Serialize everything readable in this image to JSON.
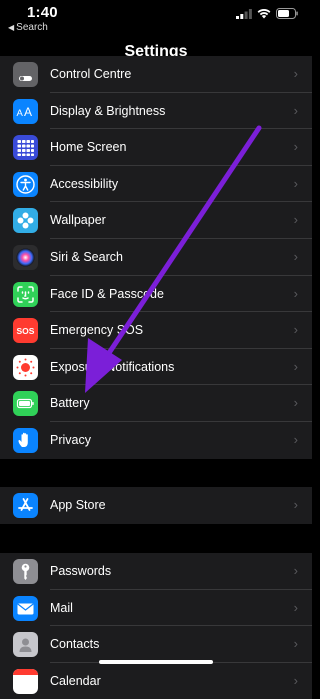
{
  "status_bar": {
    "time": "1:40",
    "back_label": "Search"
  },
  "nav": {
    "title": "Settings"
  },
  "group1": [
    {
      "label": "Control Centre",
      "icon": "control-centre-icon",
      "color": "#636366"
    },
    {
      "label": "Display & Brightness",
      "icon": "display-brightness-icon",
      "color": "#0a84ff"
    },
    {
      "label": "Home Screen",
      "icon": "home-screen-icon",
      "color": "#3a4bd8"
    },
    {
      "label": "Accessibility",
      "icon": "accessibility-icon",
      "color": "#0a84ff"
    },
    {
      "label": "Wallpaper",
      "icon": "wallpaper-icon",
      "color": "#32ade6"
    },
    {
      "label": "Siri & Search",
      "icon": "siri-icon",
      "color": "#1c1c1e"
    },
    {
      "label": "Face ID & Passcode",
      "icon": "face-id-icon",
      "color": "#30d158"
    },
    {
      "label": "Emergency SOS",
      "icon": "sos-icon",
      "color": "#ff3b30"
    },
    {
      "label": "Exposure Notifications",
      "icon": "exposure-notifications-icon",
      "color": "#ffffff"
    },
    {
      "label": "Battery",
      "icon": "battery-icon",
      "color": "#30d158"
    },
    {
      "label": "Privacy",
      "icon": "privacy-hand-icon",
      "color": "#0a84ff"
    }
  ],
  "group2": [
    {
      "label": "App Store",
      "icon": "app-store-icon",
      "color": "#0a84ff"
    }
  ],
  "group3": [
    {
      "label": "Passwords",
      "icon": "key-icon",
      "color": "#8e8e93"
    },
    {
      "label": "Mail",
      "icon": "mail-icon",
      "color": "#0a84ff"
    },
    {
      "label": "Contacts",
      "icon": "contacts-icon",
      "color": "#c7c7cc"
    },
    {
      "label": "Calendar",
      "icon": "calendar-icon",
      "color": "#ffffff"
    }
  ],
  "colors": {
    "annotation_arrow": "#7b1fd8",
    "row_background": "#1c1c1e",
    "separator": "#38383a"
  }
}
